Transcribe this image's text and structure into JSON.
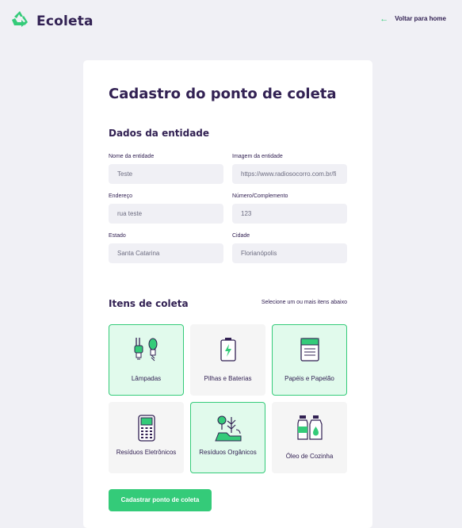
{
  "header": {
    "app_name": "Ecoleta",
    "back_label": "Voltar para home",
    "accent_color": "#34cb79"
  },
  "form": {
    "title": "Cadastro do ponto de coleta",
    "entity_section": "Dados da entidade",
    "fields": {
      "name": {
        "label": "Nome da entidade",
        "value": "Teste"
      },
      "image": {
        "label": "Imagem da entidade",
        "value": "https://www.radiosocorro.com.br/fi"
      },
      "address": {
        "label": "Endereço",
        "value": "rua teste"
      },
      "number": {
        "label": "Número/Complemento",
        "value": "123"
      },
      "state": {
        "label": "Estado",
        "value": "Santa Catarina"
      },
      "city": {
        "label": "Cidade",
        "value": "Florianópolis"
      }
    },
    "items_section": "Itens de coleta",
    "items_hint": "Selecione um ou mais itens abaixo",
    "items": [
      {
        "label": "Lâmpadas",
        "icon": "lamp-icon",
        "selected": true
      },
      {
        "label": "Pilhas e Baterias",
        "icon": "battery-icon",
        "selected": false
      },
      {
        "label": "Papéis e Papelão",
        "icon": "paper-icon",
        "selected": true
      },
      {
        "label": "Resíduos Eletrônicos",
        "icon": "electronics-icon",
        "selected": false
      },
      {
        "label": "Resíduos Orgânicos",
        "icon": "organic-icon",
        "selected": true
      },
      {
        "label": "Óleo de Cozinha",
        "icon": "oil-icon",
        "selected": false
      }
    ],
    "submit_label": "Cadastrar ponto de coleta"
  }
}
